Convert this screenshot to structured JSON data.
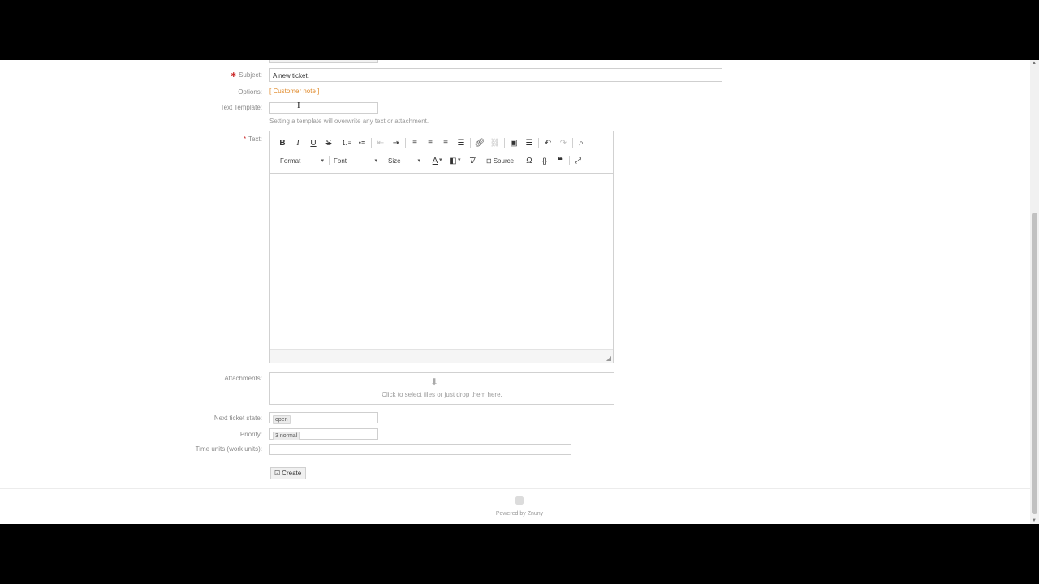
{
  "form": {
    "subject_label": "Subject:",
    "subject_value": "A new ticket.",
    "options_label": "Options:",
    "options_link": "[ Customer note ]",
    "template_label": "Text Template:",
    "template_hint": "Setting a template will overwrite any text or attachment.",
    "text_label": "Text:",
    "attachments_label": "Attachments:",
    "attachments_hint": "Click to select files or just drop them here.",
    "next_state_label": "Next ticket state:",
    "next_state_value": "open",
    "priority_label": "Priority:",
    "priority_value": "3 normal",
    "time_units_label": "Time units (work units):",
    "create_button": "Create"
  },
  "toolbar": {
    "format_label": "Format",
    "font_label": "Font",
    "size_label": "Size",
    "source_label": "Source"
  },
  "footer": {
    "powered_by": "Powered by Znuny"
  }
}
